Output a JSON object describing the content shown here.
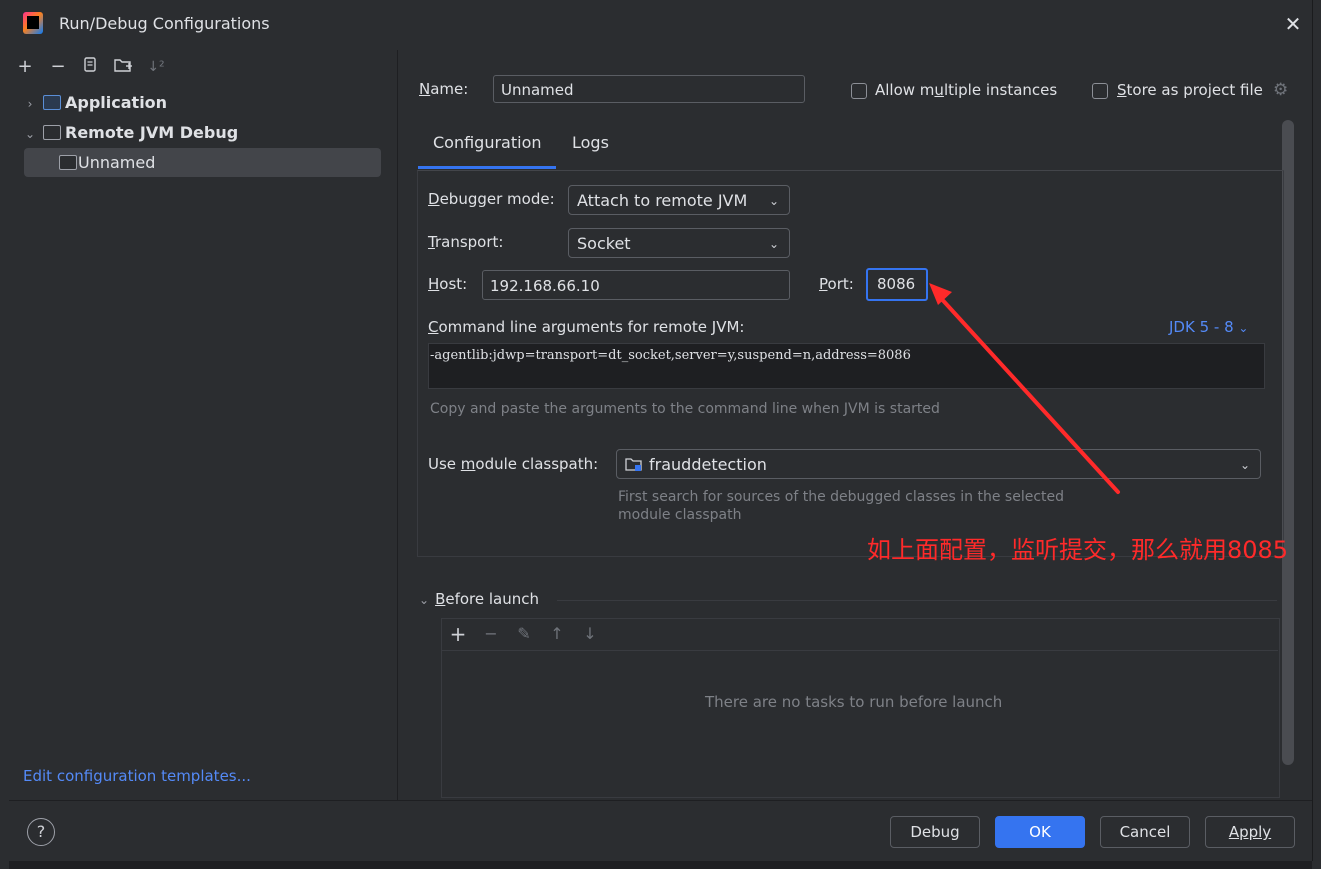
{
  "window": {
    "title": "Run/Debug Configurations",
    "close_icon": "close-icon"
  },
  "left_toolbar": [
    "add-icon",
    "remove-icon",
    "copy-icon",
    "folder-add-icon",
    "sort-icon"
  ],
  "tree": {
    "items": [
      {
        "label": "Application",
        "expanded": false
      },
      {
        "label": "Remote JVM Debug",
        "expanded": true
      },
      {
        "label": "Unnamed",
        "selected": true
      }
    ]
  },
  "edit_templates_link": "Edit configuration templates...",
  "form": {
    "name_label": "Name:",
    "name_value": "Unnamed",
    "allow_multiple_label": "Allow multiple instances",
    "store_as_project_label": "Store as project file",
    "tabs": [
      "Configuration",
      "Logs"
    ],
    "debugger_mode_label": "Debugger mode:",
    "debugger_mode_value": "Attach to remote JVM",
    "transport_label": "Transport:",
    "transport_value": "Socket",
    "host_label": "Host:",
    "host_value": "192.168.66.10",
    "port_label": "Port:",
    "port_value": "8086",
    "cmd_args_label": "Command line arguments for remote JVM:",
    "jdk_link": "JDK 5 - 8",
    "cmd_args_value": "-agentlib:jdwp=transport=dt_socket,server=y,suspend=n,address=8086",
    "cmd_hint": "Copy and paste the arguments to the command line when JVM is started",
    "classpath_label": "Use module classpath:",
    "classpath_value": "frauddetection",
    "classpath_hint_1": "First search for sources of the debugged classes in the selected",
    "classpath_hint_2": "module classpath",
    "before_launch_label": "Before launch",
    "before_launch_empty": "There are no tasks to run before launch"
  },
  "buttons": {
    "debug": "Debug",
    "ok": "OK",
    "cancel": "Cancel",
    "apply": "Apply"
  },
  "annotation": {
    "text": "如上面配置，监听提交，那么就用8085",
    "color": "#ff2a2a"
  },
  "colors": {
    "accent": "#3574f0",
    "link": "#548af7",
    "background": "#2b2d30"
  }
}
